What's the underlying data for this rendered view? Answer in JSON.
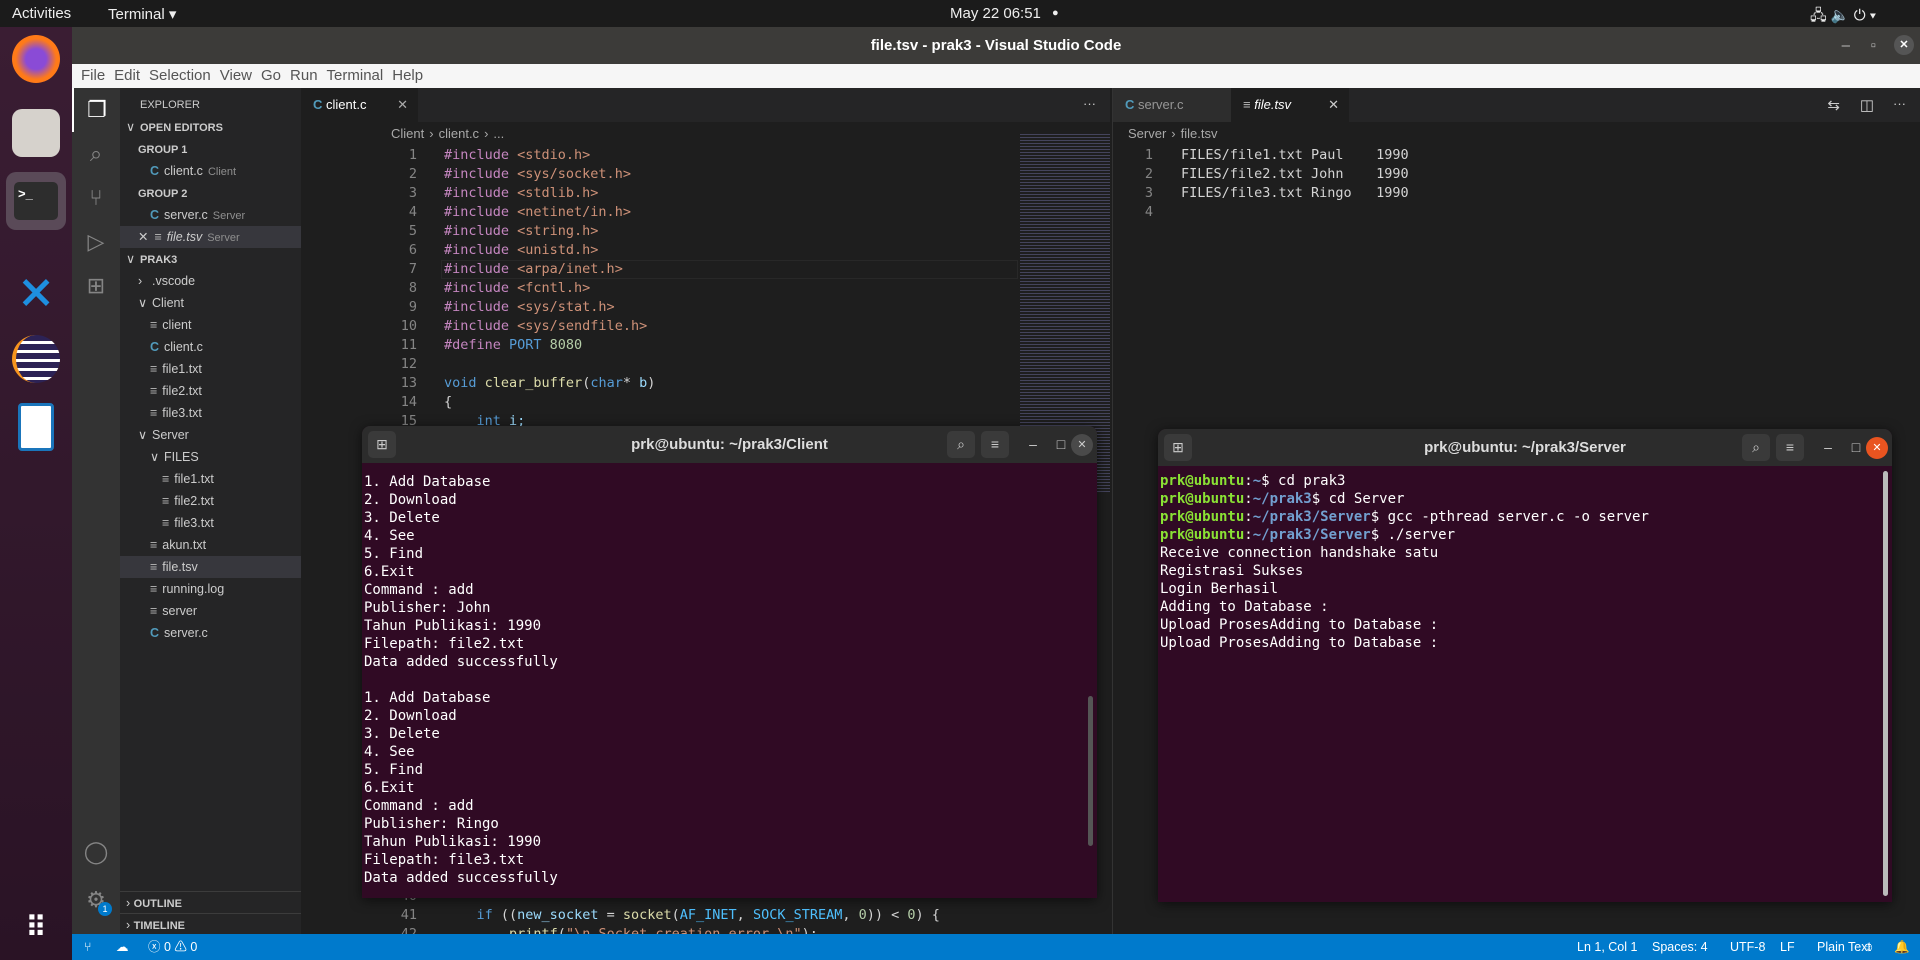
{
  "topbar": {
    "activities": "Activities",
    "app": "Terminal ▾",
    "clock": "May 22  06:51",
    "dot": "●",
    "tray": "🖧 🔈 ⏻ ▾"
  },
  "dock": [
    {
      "name": "firefox"
    },
    {
      "name": "files"
    },
    {
      "name": "terminal"
    },
    {
      "name": "vscode"
    },
    {
      "name": "eclipse"
    },
    {
      "name": "libreoffice-writer"
    }
  ],
  "window": {
    "title": "file.tsv - prak3 - Visual Studio Code",
    "controls": [
      "–",
      "▫",
      "✕"
    ]
  },
  "menu": [
    "File",
    "Edit",
    "Selection",
    "View",
    "Go",
    "Run",
    "Terminal",
    "Help"
  ],
  "sidebar": {
    "title": "EXPLORER",
    "items": [
      {
        "label": "OPEN EDITORS",
        "type": "head",
        "indent": 0,
        "chev": "∨"
      },
      {
        "label": "GROUP 1",
        "type": "group",
        "indent": 1
      },
      {
        "label": "client.c",
        "desc": "Client",
        "icon": "c",
        "indent": 2
      },
      {
        "label": "GROUP 2",
        "type": "group",
        "indent": 1
      },
      {
        "label": "server.c",
        "desc": "Server",
        "icon": "c",
        "indent": 2
      },
      {
        "label": "file.tsv",
        "desc": "Server",
        "icon": "f",
        "indent": 1,
        "close": "✕",
        "selected": true,
        "italic": true
      },
      {
        "label": "PRAK3",
        "type": "head",
        "indent": 0,
        "chev": "∨"
      },
      {
        "label": ".vscode",
        "indent": 1,
        "chev": "›"
      },
      {
        "label": "Client",
        "indent": 1,
        "chev": "∨"
      },
      {
        "label": "client",
        "icon": "f",
        "indent": 2
      },
      {
        "label": "client.c",
        "icon": "c",
        "indent": 2
      },
      {
        "label": "file1.txt",
        "icon": "f",
        "indent": 2
      },
      {
        "label": "file2.txt",
        "icon": "f",
        "indent": 2
      },
      {
        "label": "file3.txt",
        "icon": "f",
        "indent": 2
      },
      {
        "label": "Server",
        "indent": 1,
        "chev": "∨"
      },
      {
        "label": "FILES",
        "indent": 2,
        "chev": "∨"
      },
      {
        "label": "file1.txt",
        "icon": "f",
        "indent": 3
      },
      {
        "label": "file2.txt",
        "icon": "f",
        "indent": 3
      },
      {
        "label": "file3.txt",
        "icon": "f",
        "indent": 3
      },
      {
        "label": "akun.txt",
        "icon": "f",
        "indent": 2
      },
      {
        "label": "file.tsv",
        "icon": "f",
        "indent": 2,
        "selected": true
      },
      {
        "label": "running.log",
        "icon": "f",
        "indent": 2
      },
      {
        "label": "server",
        "icon": "f",
        "indent": 2
      },
      {
        "label": "server.c",
        "icon": "c",
        "indent": 2
      }
    ],
    "outline": "OUTLINE",
    "timeline": "TIMELINE",
    "settings_badge": "1"
  },
  "editor_left": {
    "tab": "client.c",
    "tab_close": "✕",
    "more": "···",
    "breadcrumb": [
      "Client",
      "›",
      "client.c",
      "›",
      "..."
    ],
    "line_count": 42,
    "lines": {
      "1": [
        [
          "#include ",
          "pp"
        ],
        [
          "<stdio.h>",
          "str"
        ]
      ],
      "2": [
        [
          "#include ",
          "pp"
        ],
        [
          "<sys/socket.h>",
          "str"
        ]
      ],
      "3": [
        [
          "#include ",
          "pp"
        ],
        [
          "<stdlib.h>",
          "str"
        ]
      ],
      "4": [
        [
          "#include ",
          "pp"
        ],
        [
          "<netinet/in.h>",
          "str"
        ]
      ],
      "5": [
        [
          "#include ",
          "pp"
        ],
        [
          "<string.h>",
          "str"
        ]
      ],
      "6": [
        [
          "#include ",
          "pp"
        ],
        [
          "<unistd.h>",
          "str"
        ]
      ],
      "7": [
        [
          "#include ",
          "pp"
        ],
        [
          "<arpa/inet.h>",
          "str"
        ]
      ],
      "8": [
        [
          "#include ",
          "pp"
        ],
        [
          "<fcntl.h>",
          "str"
        ]
      ],
      "9": [
        [
          "#include ",
          "pp"
        ],
        [
          "<sys/stat.h>",
          "str"
        ]
      ],
      "10": [
        [
          "#include ",
          "pp"
        ],
        [
          "<sys/sendfile.h>",
          "str"
        ]
      ],
      "11": [
        [
          "#define ",
          "pp"
        ],
        [
          "PORT ",
          "kw"
        ],
        [
          "8080",
          "num"
        ]
      ],
      "13": [
        [
          "void ",
          "kw"
        ],
        [
          "clear_buffer",
          "fn"
        ],
        [
          "(",
          "pl"
        ],
        [
          "char",
          "kw"
        ],
        [
          "* ",
          "pl"
        ],
        [
          "b",
          "var"
        ],
        [
          ")",
          "pl"
        ]
      ],
      "14": [
        [
          "{",
          "pl"
        ]
      ],
      "15": [
        [
          "    int ",
          "kw"
        ],
        [
          "i;",
          "var"
        ]
      ],
      "41": [
        [
          "    if ",
          "kw"
        ],
        [
          "((",
          "pl"
        ],
        [
          "new_socket",
          "var"
        ],
        [
          " = ",
          "pl"
        ],
        [
          "socket",
          "fn"
        ],
        [
          "(",
          "pl"
        ],
        [
          "AF_INET",
          "mac"
        ],
        [
          ", ",
          "pl"
        ],
        [
          "SOCK_STREAM",
          "mac"
        ],
        [
          ", ",
          "pl"
        ],
        [
          "0",
          "num"
        ],
        [
          ")) < ",
          "pl"
        ],
        [
          "0",
          "num"
        ],
        [
          ") {",
          "pl"
        ]
      ],
      "42": [
        [
          "        printf",
          "fn"
        ],
        [
          "(",
          "pl"
        ],
        [
          "\"\\n Socket creation error \\n\"",
          "str"
        ],
        [
          ");",
          "pl"
        ]
      ]
    }
  },
  "editor_right": {
    "tabs": [
      {
        "label": "server.c",
        "icon": "c"
      },
      {
        "label": "file.tsv",
        "icon": "f",
        "active": true,
        "close": "✕"
      }
    ],
    "breadcrumb": [
      "Server",
      "›",
      "file.tsv"
    ],
    "lines": [
      "FILES/file1.txt Paul    1990",
      "FILES/file2.txt John    1990",
      "FILES/file3.txt Ringo   1990",
      ""
    ]
  },
  "term_client": {
    "title": "prk@ubuntu: ~/prak3/Client",
    "lines": [
      "1. Add Database",
      "2. Download",
      "3. Delete",
      "4. See",
      "5. Find",
      "6.Exit",
      "Command : add",
      "Publisher: John",
      "Tahun Publikasi: 1990",
      "Filepath: file2.txt",
      "Data added successfully",
      "",
      "1. Add Database",
      "2. Download",
      "3. Delete",
      "4. See",
      "5. Find",
      "6.Exit",
      "Command : add",
      "Publisher: Ringo",
      "Tahun Publikasi: 1990",
      "Filepath: file3.txt",
      "Data added successfully"
    ]
  },
  "term_server": {
    "title": "prk@ubuntu: ~/prak3/Server",
    "prompts": [
      {
        "user": "prk@ubuntu",
        "path": "~",
        "cmd": "cd prak3"
      },
      {
        "user": "prk@ubuntu",
        "path": "~/prak3",
        "cmd": "cd Server"
      },
      {
        "user": "prk@ubuntu",
        "path": "~/prak3/Server",
        "cmd": "gcc -pthread server.c -o server"
      },
      {
        "user": "prk@ubuntu",
        "path": "~/prak3/Server",
        "cmd": "./server"
      }
    ],
    "output": [
      "Receive connection handshake satu",
      "Registrasi Sukses",
      "Login Berhasil",
      "Adding to Database :",
      "Upload ProsesAdding to Database :",
      "Upload ProsesAdding to Database :"
    ]
  },
  "status": {
    "errors": "0",
    "warnings": "0",
    "position": "Ln 1, Col 1",
    "spaces": "Spaces: 4",
    "encoding": "UTF-8",
    "eol": "LF",
    "language": "Plain Text"
  },
  "colors": {
    "status_bar": "#007acc",
    "terminal_bg": "#300a24",
    "prompt_user": "#8ae234",
    "prompt_path": "#729fcf"
  }
}
